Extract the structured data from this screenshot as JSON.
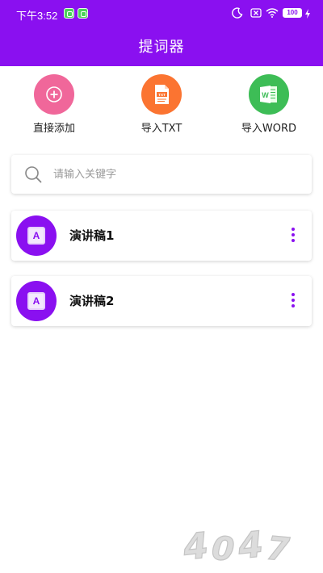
{
  "status": {
    "time": "下午3:52",
    "battery": "100"
  },
  "header": {
    "title": "提词器"
  },
  "actions": [
    {
      "label": "直接添加",
      "color": "#f0679a"
    },
    {
      "label": "导入TXT",
      "color": "#fb7431",
      "badge": "TXT"
    },
    {
      "label": "导入WORD",
      "color": "#3dbd56",
      "badge": "W"
    }
  ],
  "search": {
    "placeholder": "请输入关键字"
  },
  "scripts": [
    {
      "name": "演讲稿1",
      "icon_letter": "A"
    },
    {
      "name": "演讲稿2",
      "icon_letter": "A"
    }
  ],
  "colors": {
    "accent": "#8a10f0"
  }
}
